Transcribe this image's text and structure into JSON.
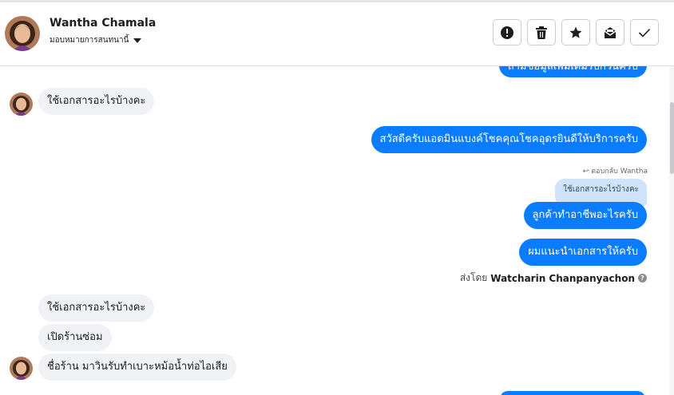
{
  "header": {
    "contact_name": "Wantha Chamala",
    "assign_label": "มอบหมายการสนทนานี้",
    "actions": [
      {
        "icon": "alert-icon"
      },
      {
        "icon": "trash-icon"
      },
      {
        "icon": "star-icon"
      },
      {
        "icon": "mark-unread-icon"
      },
      {
        "icon": "checkmark-icon"
      }
    ]
  },
  "messages": {
    "top_cut": "ถามข้อมูลเพิ่มเติมรบกวนครับ",
    "m1": "ใช้เอกสารอะไรบ้างคะ",
    "m2": "สวัสดีครับแอดมินแบงค์โชคคุณโชคอุดรยินดีให้บริการครับ",
    "reply_note": "ตอบกลับ Wantha",
    "reply_quote": "ใช้เอกสารอะไรบ้างคะ",
    "m3": "ลูกค้าทำอาชีพอะไรครับ",
    "m4": "ผมแนะนำเอกสารให้ครับ",
    "sent_by_prefix": "ส่งโดย",
    "sent_by_name": "Watcharin Chanpanyachon",
    "m5": "ใช้เอกสารอะไรบ้างคะ",
    "m6": "เปิดร้านซ่อม",
    "m7": "ชื่อร้าน มาวินรับทำเบาะหม้อน้ำท่อไอเสีย"
  },
  "colors": {
    "outgoing": "#0a7cff",
    "incoming": "#f0f2f5",
    "reply_quote": "#cfe3fb"
  }
}
